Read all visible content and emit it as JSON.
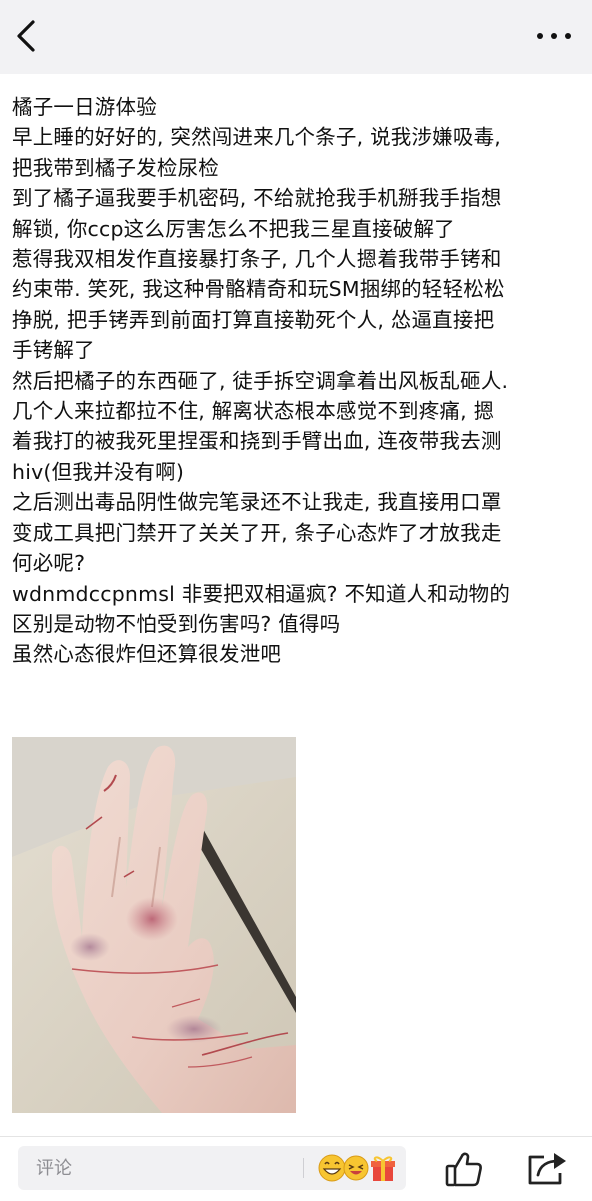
{
  "header": {
    "back_icon": "chevron-left-icon",
    "more_icon": "more-horizontal-icon"
  },
  "post": {
    "lines": [
      "橘子一日游体验",
      "早上睡的好好的, 突然闯进来几个条子, 说我涉嫌吸毒,",
      "把我带到橘子发检尿检",
      "到了橘子逼我要手机密码, 不给就抢我手机掰我手指想",
      "解锁, 你ccp这么厉害怎么不把我三星直接破解了",
      "惹得我双相发作直接暴打条子, 几个人摁着我带手铐和",
      "约束带. 笑死, 我这种骨骼精奇和玩SM捆绑的轻轻松松",
      "挣脱, 把手铐弄到前面打算直接勒死个人, 怂逼直接把",
      "手铐解了",
      "然后把橘子的东西砸了, 徒手拆空调拿着出风板乱砸人.",
      "几个人来拉都拉不住, 解离状态根本感觉不到疼痛, 摁",
      "着我打的被我死里捏蛋和挠到手臂出血, 连夜带我去测",
      "hiv(但我并没有啊)",
      "之后测出毒品阴性做完笔录还不让我走, 我直接用口罩",
      "变成工具把门禁开了关关了开, 条子心态炸了才放我走",
      "何必呢?",
      "wdnmdccpnmsl 非要把双相逼疯? 不知道人和动物的",
      "区别是动物不怕受到伤害吗? 值得吗",
      "虽然心态很炸但还算很发泄吧"
    ],
    "photo": "photo-of-scratched-hand-and-wrist"
  },
  "footer": {
    "comment_placeholder": "评论",
    "emoji_icon": "emoji-picker-icon",
    "like_icon": "thumbs-up-icon",
    "share_icon": "share-icon"
  },
  "colors": {
    "topbar_bg": "#f2f2f4",
    "text": "#111111",
    "placeholder": "#8e8e93"
  }
}
